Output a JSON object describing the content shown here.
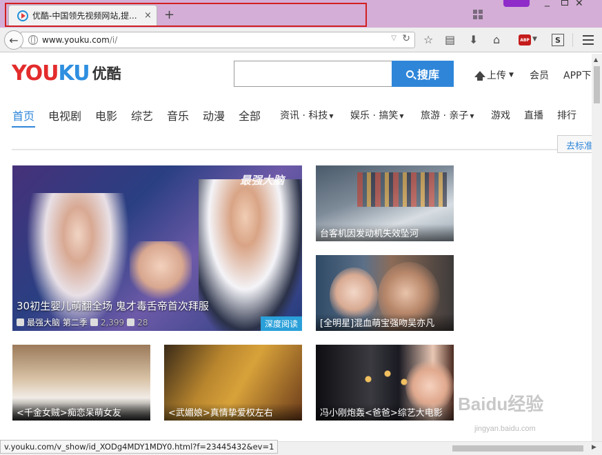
{
  "browser": {
    "tab_title": "优酷-中国领先视频网站,提...",
    "tab_close": "×",
    "new_tab": "+",
    "url_host": "www.youku.com",
    "url_path": "/i/",
    "abp_label": "ABP",
    "s_label": "S",
    "status_url": "v.youku.com/v_show/id_XODg4MDY1MDY0.html?f=23445432&ev=1"
  },
  "header": {
    "logo_en_1": "YOU",
    "logo_en_2": "KU",
    "logo_cn": "优酷",
    "search_placeholder": "",
    "search_button": "搜库",
    "upload": "上传",
    "member": "会员",
    "app_download": "APP下"
  },
  "nav": {
    "items": [
      "首页",
      "电视剧",
      "电影",
      "综艺",
      "音乐",
      "动漫",
      "全部",
      "资讯 · 科技",
      "娱乐 · 搞笑",
      "旅游 · 亲子",
      "游戏",
      "直播",
      "排行"
    ],
    "return_old": "去标准"
  },
  "hero": {
    "badge": "最强大脑",
    "title": "30初生婴儿萌翻全场 鬼才毒舌帝首次拜服",
    "show": "最强大脑 第二季",
    "plays": "2,399",
    "comments": "28",
    "deep_read": "深度阅读"
  },
  "tiles": [
    {
      "caption": "台客机因发动机失效坠河"
    },
    {
      "caption": "[全明星]混血萌宝强吻吴亦凡"
    },
    {
      "caption": "<千金女贼>痴恋呆萌女友"
    },
    {
      "caption": "<武媚娘>真情挚爱权左右"
    },
    {
      "caption": "冯小刚炮轰<爸爸>综艺大电影"
    }
  ],
  "watermark": {
    "brand": "Baidu经验",
    "sub": "jingyan.baidu.com"
  },
  "colors": {
    "accent": "#2f86d9",
    "logo_red": "#e32c2c",
    "logo_blue": "#2f8fe0",
    "titlebar": "#d4aed6",
    "tab_highlight": "#d21f1f"
  }
}
